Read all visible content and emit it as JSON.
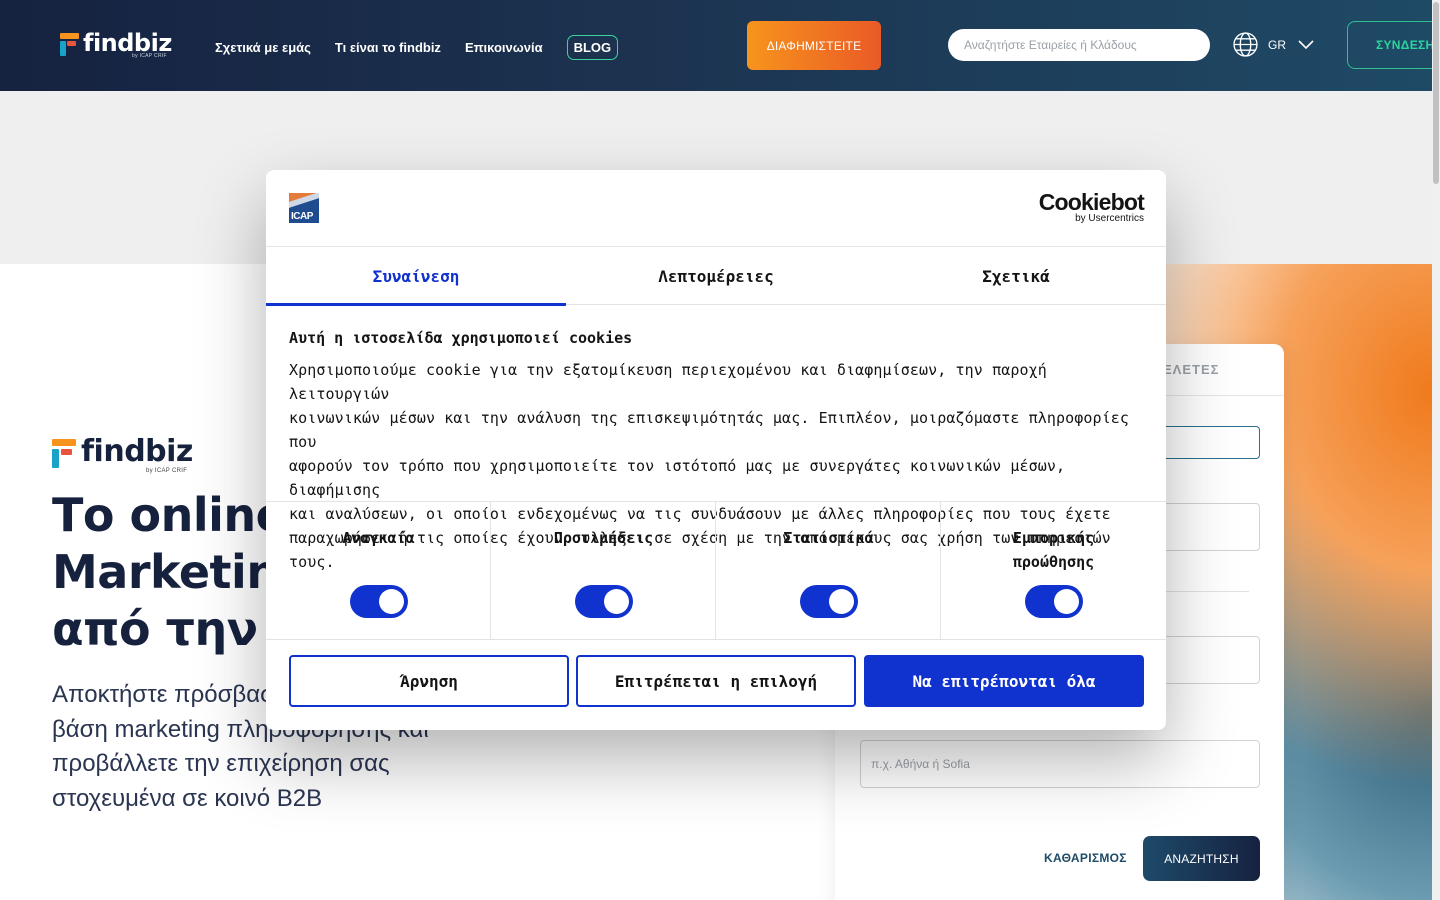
{
  "header": {
    "logo_text": "findbiz",
    "logo_sub": "by ICAP CRIF",
    "nav": [
      "Σχετικά με εμάς",
      "Τι είναι το findbiz",
      "Επικοινωνία"
    ],
    "blog_label": "BLOG",
    "advertise_label": "ΔΙΑΦΗΜΙΣΤΕΙΤΕ",
    "search_placeholder": "Αναζητήστε Εταιρείες ή Κλάδους",
    "language": "GR",
    "login_label": "ΣΥΝΔΕΣΗ"
  },
  "hero": {
    "logo_text": "findbiz",
    "logo_sub": "by ICAP CRIF",
    "title_lines": [
      "Το online S",
      "Marketing",
      "από την IC"
    ],
    "subtitle_lines": [
      "Αποκτήστε πρόσβασ",
      "βάση marketing πληροφόρησης και",
      "προβάλλετε την επιχείρηση σας",
      "στοχευμένα σε κοινό B2B"
    ]
  },
  "search_card": {
    "tab_label": "ΕΛΕΤΕΣ",
    "city_placeholder": "π.χ. Αθήνα ή Sofia",
    "clear_label": "ΚΑΘΑΡΙΣΜΟΣ",
    "search_label": "ΑΝΑΖΗΤΗΣΗ"
  },
  "cookie_dialog": {
    "brand_logo_text": "ICAP",
    "provider_name": "Cookiebot",
    "provider_sub": "by Usercentrics",
    "tabs": [
      "Συναίνεση",
      "Λεπτομέρειες",
      "Σχετικά"
    ],
    "active_tab": 0,
    "heading": "Αυτή η ιστοσελίδα χρησιμοποιεί cookies",
    "body_lines": [
      "Χρησιμοποιούμε cookie για την εξατομίκευση περιεχομένου και διαφημίσεων, την παροχή λειτουργιών",
      "κοινωνικών μέσων και την ανάλυση της επισκεψιμότητάς μας. Επιπλέον, μοιραζόμαστε πληροφορίες που",
      "αφορούν τον τρόπο που χρησιμοποιείτε τον ιστότοπό μας με συνεργάτες κοινωνικών μέσων, διαφήμισης",
      "και αναλύσεων, οι οποίοι ενδεχομένως να τις συνδυάσουν με άλλες πληροφορίες που τους έχετε",
      "παραχωρήσει ή τις οποίες έχουν συλλέξει σε σχέση με την από μέρους σας χρήση των υπηρεσιών τους."
    ],
    "categories": [
      {
        "label_lines": [
          "Αναγκαία"
        ],
        "enabled": true
      },
      {
        "label_lines": [
          "Προτιμήσεις"
        ],
        "enabled": true
      },
      {
        "label_lines": [
          "Στατιστικά"
        ],
        "enabled": true
      },
      {
        "label_lines": [
          "Εμπορικής",
          "προώθησης"
        ],
        "enabled": true
      }
    ],
    "deny_label": "Άρνηση",
    "allow_selection_label": "Επιτρέπεται η επιλογή",
    "allow_all_label": "Να επιτρέπονται όλα"
  },
  "colors": {
    "accent": "#1032cf",
    "header_dark": "#152240",
    "brand_orange": "#f7941d",
    "brand_green": "#2fd3a0"
  }
}
